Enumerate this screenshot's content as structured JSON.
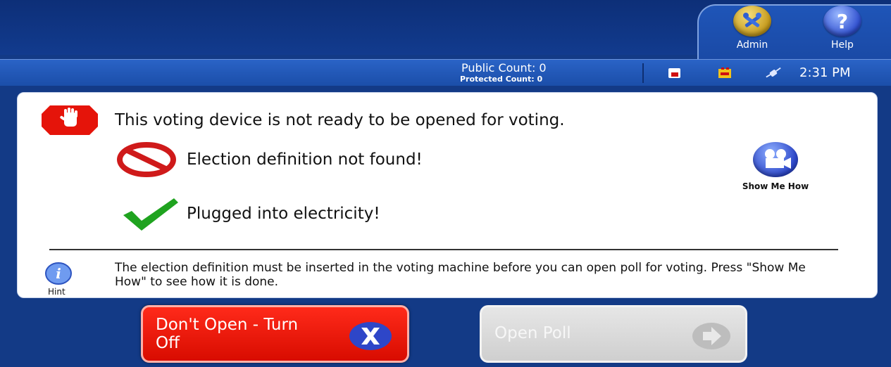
{
  "header": {
    "admin_label": "Admin",
    "help_label": "Help",
    "admin_icon": "tools-icon",
    "help_icon": "question-mark-icon"
  },
  "status": {
    "public_count": "Public Count: 0",
    "protected_count": "Protected Count: 0",
    "time": "2:31 PM",
    "icons": [
      "memory-card-icon",
      "battery-icon",
      "power-plug-icon"
    ]
  },
  "panel": {
    "main_message": "This voting device is not ready to be opened for voting.",
    "checks": [
      {
        "text": "Election definition not found!",
        "status": "fail"
      },
      {
        "text": "Plugged into electricity!",
        "status": "ok"
      }
    ],
    "show_me_how_label": "Show Me How",
    "hint_text": "The election definition must be inserted in the voting machine before you can open poll for voting.  Press \"Show Me How\" to see how it is done.",
    "hint_label": "Hint"
  },
  "buttons": {
    "dont_open": "Don't Open - Turn Off",
    "open_poll": "Open Poll"
  },
  "colors": {
    "background": "#133a86",
    "danger": "#e5140a",
    "ok": "#1fa31f",
    "disabled": "#d9d9d9"
  }
}
